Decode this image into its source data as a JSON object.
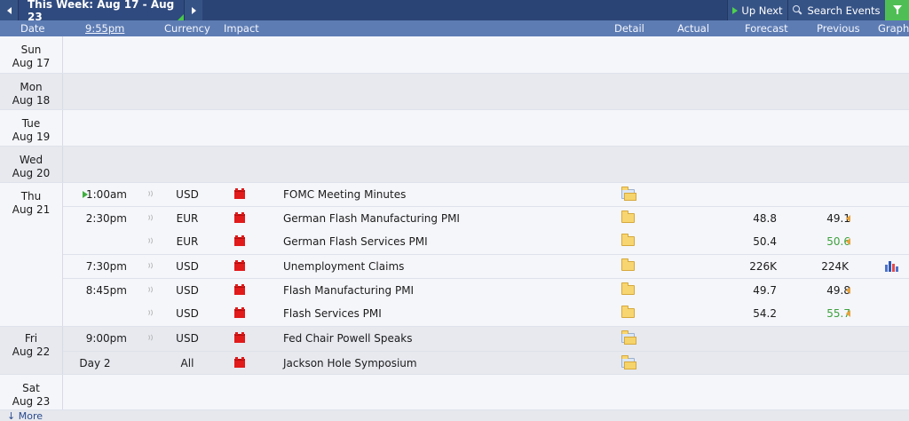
{
  "topbar": {
    "week_label": "This Week: Aug 17 - Aug 23",
    "up_next_label": "Up Next",
    "search_label": "Search Events"
  },
  "header": {
    "date": "Date",
    "time": "9:55pm",
    "currency": "Currency",
    "impact": "Impact",
    "detail": "Detail",
    "actual": "Actual",
    "forecast": "Forecast",
    "previous": "Previous",
    "graph": "Graph"
  },
  "days": [
    {
      "dow": "Sun",
      "date": "Aug 17"
    },
    {
      "dow": "Mon",
      "date": "Aug 18"
    },
    {
      "dow": "Tue",
      "date": "Aug 19"
    },
    {
      "dow": "Wed",
      "date": "Aug 20"
    },
    {
      "dow": "Thu",
      "date": "Aug 21"
    },
    {
      "dow": "Fri",
      "date": "Aug 22"
    },
    {
      "dow": "Sat",
      "date": "Aug 23"
    }
  ],
  "events": [
    {
      "time": "1:00am",
      "currency": "USD",
      "name": "FOMC Meeting Minutes",
      "forecast": "",
      "previous": ""
    },
    {
      "time": "2:30pm",
      "currency": "EUR",
      "name": "German Flash Manufacturing PMI",
      "forecast": "48.8",
      "previous": "49.1"
    },
    {
      "time": "",
      "currency": "EUR",
      "name": "German Flash Services PMI",
      "forecast": "50.4",
      "previous": "50.6"
    },
    {
      "time": "7:30pm",
      "currency": "USD",
      "name": "Unemployment Claims",
      "forecast": "226K",
      "previous": "224K"
    },
    {
      "time": "8:45pm",
      "currency": "USD",
      "name": "Flash Manufacturing PMI",
      "forecast": "49.7",
      "previous": "49.8"
    },
    {
      "time": "",
      "currency": "USD",
      "name": "Flash Services PMI",
      "forecast": "54.2",
      "previous": "55.7"
    },
    {
      "time": "9:00pm",
      "currency": "USD",
      "name": "Fed Chair Powell Speaks",
      "forecast": "",
      "previous": ""
    },
    {
      "time": "Day 2",
      "currency": "All",
      "name": "Jackson Hole Symposium",
      "forecast": "",
      "previous": ""
    }
  ],
  "icons": {
    "impact": "high-impact-folder-icon",
    "detail_closed": "detail-folder-icon",
    "detail_open": "detail-open-folder-icon",
    "sound": "sound-wave-icon",
    "graph": "bar-graph-icon",
    "revision": "revision-arrow-icon"
  },
  "colors": {
    "topbar": "#2b4476",
    "header": "#5d7cb4",
    "filter": "#4fbf55",
    "impact_high": "#e11a1a",
    "previous_better": "#3da13d"
  },
  "more_label": "More"
}
